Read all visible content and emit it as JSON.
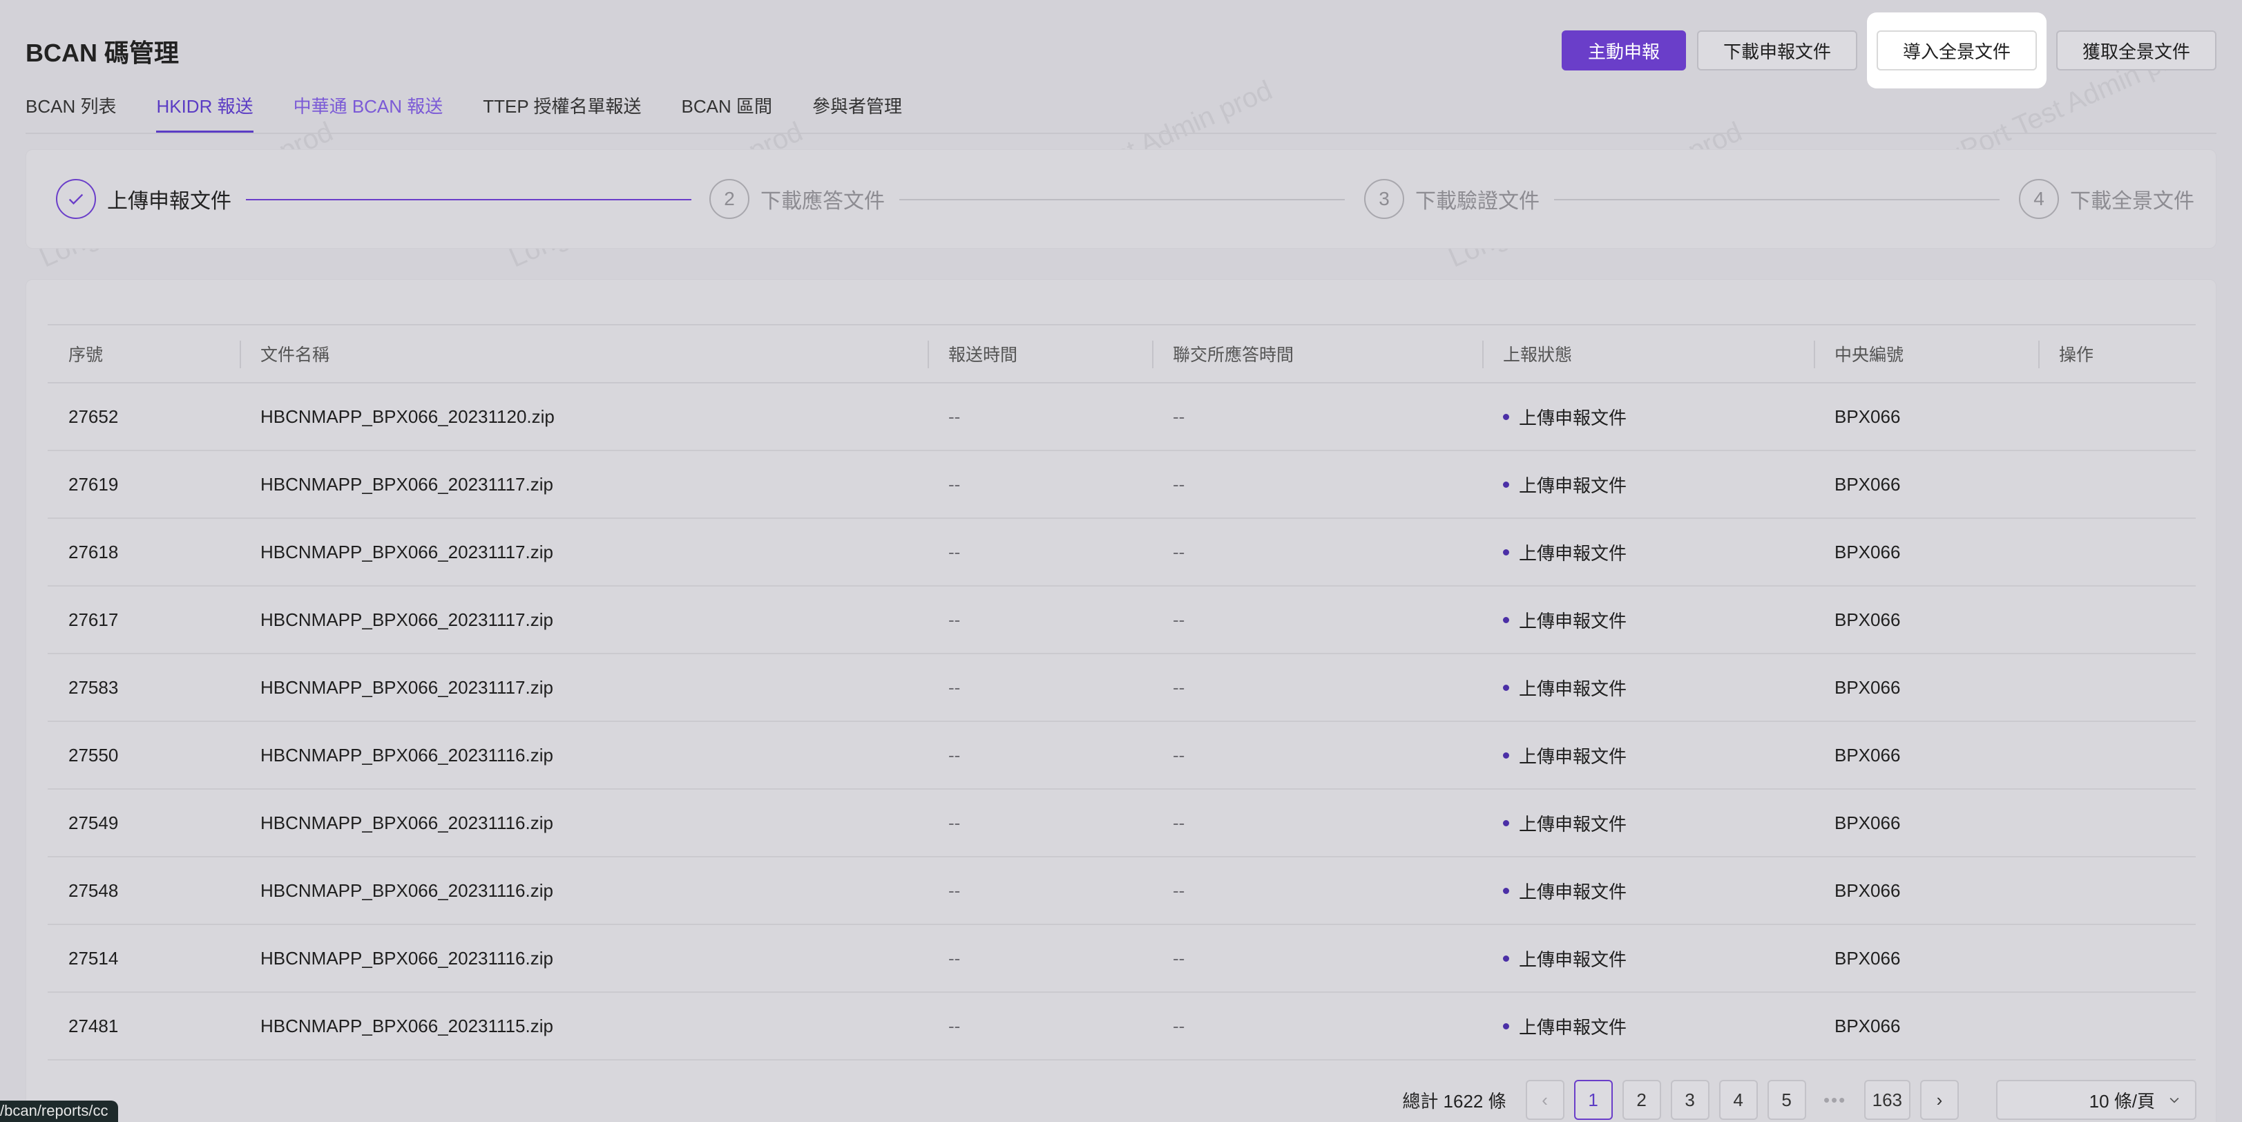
{
  "header": {
    "title": "BCAN 碼管理",
    "buttons": {
      "submit": "主動申報",
      "download_report": "下載申報文件",
      "import_panorama": "導入全景文件",
      "fetch_panorama": "獲取全景文件"
    }
  },
  "tabs": [
    {
      "label": "BCAN 列表"
    },
    {
      "label": "HKIDR 報送"
    },
    {
      "label": "中華通 BCAN 報送"
    },
    {
      "label": "TTEP 授權名單報送"
    },
    {
      "label": "BCAN 區間"
    },
    {
      "label": "參與者管理"
    }
  ],
  "steps": [
    {
      "num": "✓",
      "label": "上傳申報文件"
    },
    {
      "num": "2",
      "label": "下載應答文件"
    },
    {
      "num": "3",
      "label": "下載驗證文件"
    },
    {
      "num": "4",
      "label": "下載全景文件"
    }
  ],
  "table": {
    "columns": [
      "序號",
      "文件名稱",
      "報送時間",
      "聯交所應答時間",
      "上報狀態",
      "中央編號",
      "操作"
    ],
    "rows": [
      {
        "id": "27652",
        "file": "HBCNMAPP_BPX066_20231120.zip",
        "sent": "--",
        "resp": "--",
        "status": "上傳申報文件",
        "code": "BPX066"
      },
      {
        "id": "27619",
        "file": "HBCNMAPP_BPX066_20231117.zip",
        "sent": "--",
        "resp": "--",
        "status": "上傳申報文件",
        "code": "BPX066"
      },
      {
        "id": "27618",
        "file": "HBCNMAPP_BPX066_20231117.zip",
        "sent": "--",
        "resp": "--",
        "status": "上傳申報文件",
        "code": "BPX066"
      },
      {
        "id": "27617",
        "file": "HBCNMAPP_BPX066_20231117.zip",
        "sent": "--",
        "resp": "--",
        "status": "上傳申報文件",
        "code": "BPX066"
      },
      {
        "id": "27583",
        "file": "HBCNMAPP_BPX066_20231117.zip",
        "sent": "--",
        "resp": "--",
        "status": "上傳申報文件",
        "code": "BPX066"
      },
      {
        "id": "27550",
        "file": "HBCNMAPP_BPX066_20231116.zip",
        "sent": "--",
        "resp": "--",
        "status": "上傳申報文件",
        "code": "BPX066"
      },
      {
        "id": "27549",
        "file": "HBCNMAPP_BPX066_20231116.zip",
        "sent": "--",
        "resp": "--",
        "status": "上傳申報文件",
        "code": "BPX066"
      },
      {
        "id": "27548",
        "file": "HBCNMAPP_BPX066_20231116.zip",
        "sent": "--",
        "resp": "--",
        "status": "上傳申報文件",
        "code": "BPX066"
      },
      {
        "id": "27514",
        "file": "HBCNMAPP_BPX066_20231116.zip",
        "sent": "--",
        "resp": "--",
        "status": "上傳申報文件",
        "code": "BPX066"
      },
      {
        "id": "27481",
        "file": "HBCNMAPP_BPX066_20231115.zip",
        "sent": "--",
        "resp": "--",
        "status": "上傳申報文件",
        "code": "BPX066"
      }
    ]
  },
  "pagination": {
    "total": "總計 1622 條",
    "prev": "‹",
    "next": "›",
    "pages": [
      "1",
      "2",
      "3",
      "4",
      "5"
    ],
    "ellipsis": "•••",
    "last": "163",
    "page_size": "10 條/頁"
  },
  "status_url": "/bcan/reports/cc",
  "watermark": "LongPort Test Admin prod",
  "colors": {
    "accent": "#6a3ec9",
    "background": "#d3d2d8",
    "card": "#d8d7dc"
  }
}
